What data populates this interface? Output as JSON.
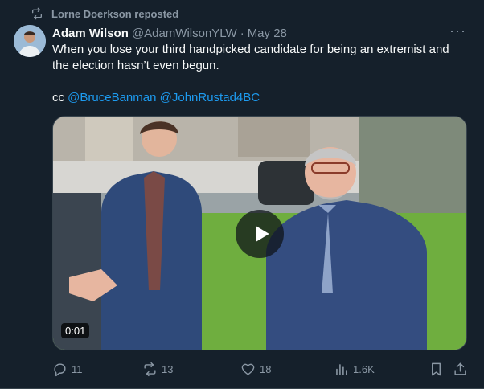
{
  "repost": {
    "text": "Lorne Doerkson reposted",
    "icon": "repost-icon"
  },
  "author": {
    "name": "Adam Wilson",
    "handle": "@AdamWilsonYLW",
    "separator": "·",
    "date": "May 28"
  },
  "more_icon": "more-icon",
  "tweet": {
    "line1": "When you lose your third handpicked candidate for being an extremist and",
    "line2": "the election hasn’t even begun.",
    "cc_prefix": "cc",
    "mention1": "@BruceBanman",
    "mention2": "@JohnRustad4BC"
  },
  "video": {
    "timecode": "0:01",
    "play_icon": "play-icon"
  },
  "actions": {
    "replies": "11",
    "reposts": "13",
    "likes": "18",
    "views": "1.6K"
  },
  "colors": {
    "background": "#15202b",
    "accent": "#1d9bf0",
    "muted": "#8b98a5"
  }
}
